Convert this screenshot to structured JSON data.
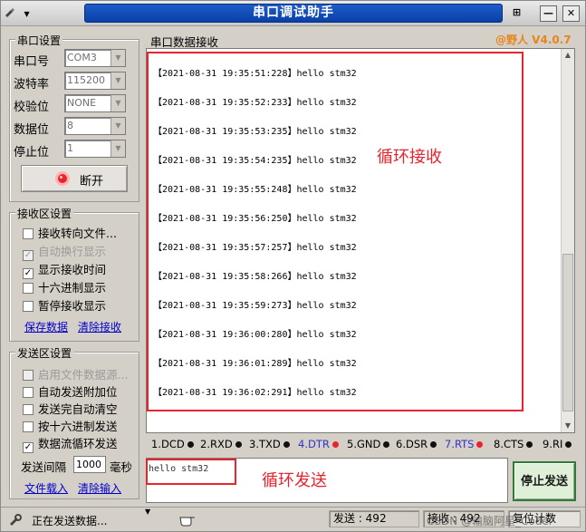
{
  "window": {
    "title": "串口调试助手",
    "sys_menu_arrow": "▼",
    "controls": {
      "pin": "⊞",
      "minimize": "—",
      "close": "✕"
    }
  },
  "serial_settings": {
    "group_title": "串口设置",
    "port_label": "串口号",
    "port_value": "COM3",
    "baud_label": "波特率",
    "baud_value": "115200",
    "parity_label": "校验位",
    "parity_value": "NONE",
    "databits_label": "数据位",
    "databits_value": "8",
    "stopbits_label": "停止位",
    "stopbits_value": "1",
    "toggle_button": "断开"
  },
  "receive_settings": {
    "group_title": "接收区设置",
    "options": [
      {
        "label": "接收转向文件...",
        "checked": false,
        "disabled": false
      },
      {
        "label": "自动换行显示",
        "checked": true,
        "disabled": true
      },
      {
        "label": "显示接收时间",
        "checked": true,
        "disabled": false
      },
      {
        "label": "十六进制显示",
        "checked": false,
        "disabled": false
      },
      {
        "label": "暂停接收显示",
        "checked": false,
        "disabled": false
      }
    ],
    "save_link": "保存数据",
    "clear_link": "清除接收"
  },
  "send_settings": {
    "group_title": "发送区设置",
    "options": [
      {
        "label": "启用文件数据源...",
        "checked": false,
        "disabled": true
      },
      {
        "label": "自动发送附加位",
        "checked": false,
        "disabled": false
      },
      {
        "label": "发送完自动清空",
        "checked": false,
        "disabled": false
      },
      {
        "label": "按十六进制发送",
        "checked": false,
        "disabled": false
      },
      {
        "label": "数据流循环发送",
        "checked": true,
        "disabled": false
      }
    ],
    "interval_label": "发送间隔",
    "interval_value": "1000",
    "interval_unit": "毫秒",
    "load_file_link": "文件载入",
    "clear_input_link": "清除输入"
  },
  "receive_area": {
    "title": "串口数据接收",
    "brand": "@野人 V4.0.7",
    "lines": [
      "【2021-08-31 19:35:51:228】hello stm32",
      "【2021-08-31 19:35:52:233】hello stm32",
      "【2021-08-31 19:35:53:235】hello stm32",
      "【2021-08-31 19:35:54:235】hello stm32",
      "【2021-08-31 19:35:55:248】hello stm32",
      "【2021-08-31 19:35:56:250】hello stm32",
      "【2021-08-31 19:35:57:257】hello stm32",
      "【2021-08-31 19:35:58:266】hello stm32",
      "【2021-08-31 19:35:59:273】hello stm32",
      "【2021-08-31 19:36:00:280】hello stm32",
      "【2021-08-31 19:36:01:289】hello stm32",
      "【2021-08-31 19:36:02:291】hello stm32"
    ],
    "annotation": "循环接收",
    "annotation_color": "#e8232e"
  },
  "signals": [
    {
      "label": "1.DCD",
      "color": "#000000"
    },
    {
      "label": "2.RXD",
      "color": "#000000"
    },
    {
      "label": "3.TXD",
      "color": "#000000"
    },
    {
      "label": "4.DTR",
      "color": "#3333cc"
    },
    {
      "label": "5.GND",
      "color": "#000000"
    },
    {
      "label": "6.DSR",
      "color": "#000000"
    },
    {
      "label": "7.RTS",
      "color": "#3333cc"
    },
    {
      "label": "8.CTS",
      "color": "#000000"
    },
    {
      "label": "9.RI",
      "color": "#000000"
    }
  ],
  "signal_dot_colors": [
    "#111111",
    "#111111",
    "#111111",
    "#e8232e",
    "#111111",
    "#111111",
    "#e8232e",
    "#111111",
    "#111111"
  ],
  "send_area": {
    "text": "hello stm32",
    "annotation": "循环发送",
    "stop_button": "停止发送"
  },
  "status_bar": {
    "status_text": "正在发送数据...",
    "sent_label": "发送 : 492",
    "received_label": "接收 : 492",
    "reset_label": "复位计数",
    "watermark": "CSDN @输脑阿星_Coder"
  }
}
